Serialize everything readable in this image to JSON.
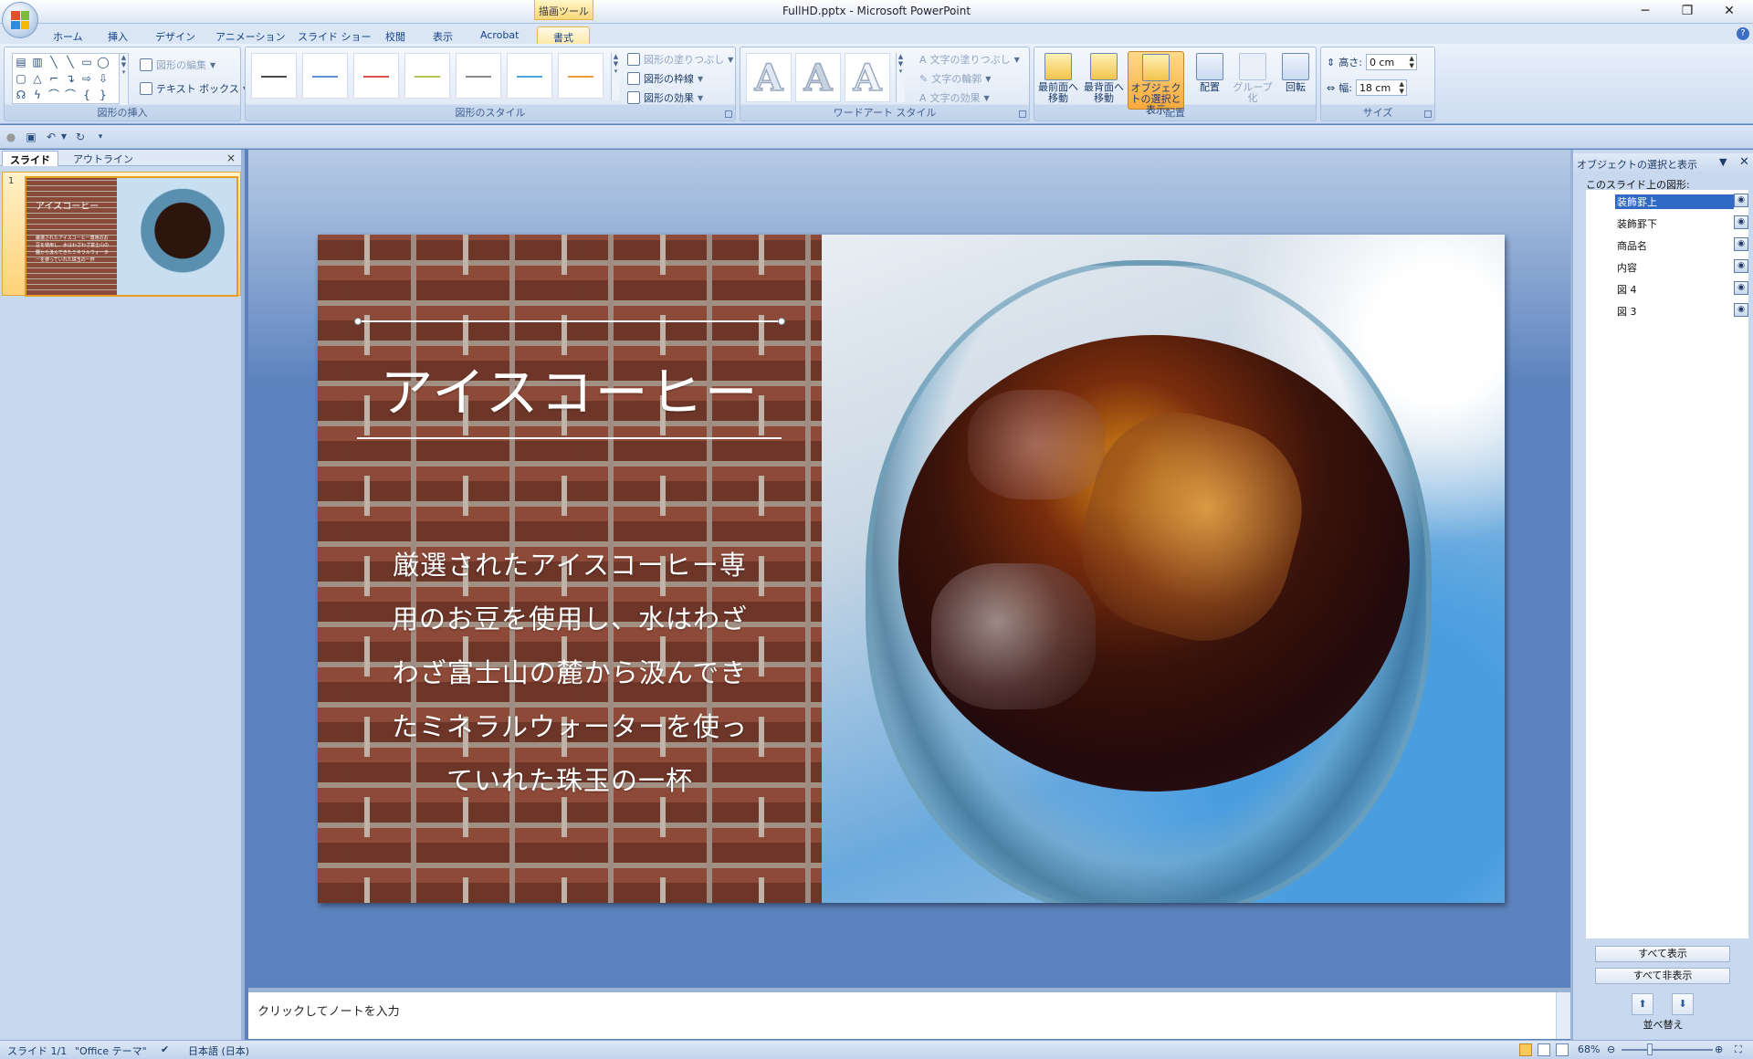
{
  "window": {
    "title": "FullHD.pptx - Microsoft PowerPoint",
    "context_tab_group": "描画ツール",
    "controls": [
      "minimize",
      "restore",
      "close"
    ]
  },
  "ribbon_tabs": [
    "ホーム",
    "挿入",
    "デザイン",
    "アニメーション",
    "スライド ショー",
    "校閲",
    "表示",
    "Acrobat",
    "書式"
  ],
  "active_tab": "書式",
  "ribbon": {
    "insert_shapes": {
      "label": "図形の挿入",
      "edit_shape": "図形の編集",
      "text_box": "テキスト ボックス"
    },
    "shape_styles": {
      "label": "図形のスタイル",
      "fill": "図形の塗りつぶし",
      "outline": "図形の枠線",
      "effects": "図形の効果",
      "swatch_colors": [
        "#4a4a4a",
        "#5b8fd6",
        "#d9534f",
        "#b7c64b",
        "#8a8a8a",
        "#4aa8d8",
        "#f0963c"
      ]
    },
    "wordart": {
      "label": "ワードアート スタイル",
      "text_fill": "文字の塗りつぶし",
      "text_outline": "文字の輪郭",
      "text_effects": "文字の効果"
    },
    "arrange": {
      "label": "配置",
      "bring_front": "最前面へ移動",
      "send_back": "最背面へ移動",
      "selection_pane": "オブジェクトの選択と表示",
      "align": "配置",
      "group": "グループ化",
      "rotate": "回転"
    },
    "size": {
      "label": "サイズ",
      "height_label": "高さ:",
      "height_value": "0 cm",
      "width_label": "幅:",
      "width_value": "18 cm"
    }
  },
  "left_pane": {
    "tabs": [
      "スライド",
      "アウトライン"
    ],
    "active_tab": "スライド",
    "slide_number": "1"
  },
  "slide": {
    "title": "アイスコーヒー",
    "body": "厳選されたアイスコーヒー専用のお豆を使用し、水はわざわざ富士山の麓から汲んできたミネラルウォーターを使っていれた珠玉の一杯",
    "body_lines": [
      "厳選されたアイスコーヒー専",
      "用のお豆を使用し、水はわざ",
      "わざ富士山の麓から汲んでき",
      "たミネラルウォーターを使っ",
      "ていれた珠玉の一杯"
    ]
  },
  "notes": {
    "placeholder": "クリックしてノートを入力"
  },
  "selection_pane": {
    "title": "オブジェクトの選択と表示",
    "caption": "このスライド上の図形:",
    "shapes": [
      {
        "name": "装飾罫上",
        "selected": true
      },
      {
        "name": "装飾罫下",
        "selected": false
      },
      {
        "name": "商品名",
        "selected": false
      },
      {
        "name": "内容",
        "selected": false
      },
      {
        "name": "図 4",
        "selected": false
      },
      {
        "name": "図 3",
        "selected": false
      }
    ],
    "show_all": "すべて表示",
    "hide_all": "すべて非表示",
    "reorder": "並べ替え"
  },
  "status": {
    "slide": "スライド 1/1",
    "theme": "\"Office テーマ\"",
    "language": "日本語 (日本)",
    "zoom": "68%"
  }
}
